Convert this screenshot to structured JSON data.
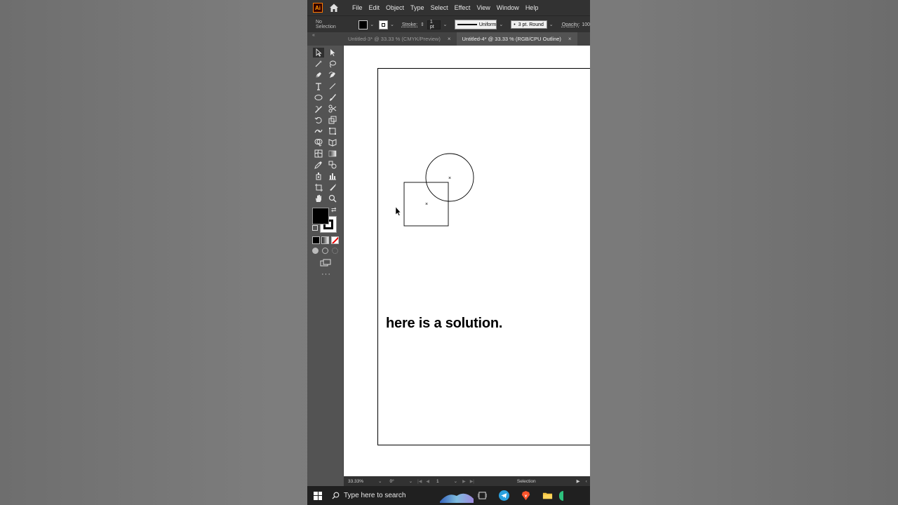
{
  "app": {
    "logo_text": "Ai",
    "brand_color": "#ff9a00"
  },
  "menubar": {
    "items": [
      "File",
      "Edit",
      "Object",
      "Type",
      "Select",
      "Effect",
      "View",
      "Window",
      "Help"
    ]
  },
  "controlbar": {
    "selection_label": "No Selection",
    "stroke_label": "Stroke:",
    "stroke_value": "1 pt",
    "profile_label": "Uniform",
    "brush_label": "3 pt. Round",
    "opacity_label": "Opacity:",
    "opacity_value": "100"
  },
  "tabs": [
    {
      "label": "Untitled-3* @ 33.33 % (CMYK/Preview)",
      "active": false
    },
    {
      "label": "Untitled-4* @ 33.33 % (RGB/CPU Outline)",
      "active": true
    }
  ],
  "tools": [
    "selection-tool",
    "direct-selection-tool",
    "magic-wand-tool",
    "lasso-tool",
    "pen-tool",
    "curvature-tool",
    "type-tool",
    "line-tool",
    "ellipse-tool",
    "paintbrush-tool",
    "shaper-tool",
    "scissors-tool",
    "rotate-tool",
    "scale-tool",
    "puppet-warp-tool",
    "free-transform-tool",
    "shape-builder-tool",
    "perspective-grid-tool",
    "mesh-tool",
    "gradient-tool",
    "eyedropper-tool",
    "blend-tool",
    "symbol-sprayer-tool",
    "column-graph-tool",
    "artboard-tool",
    "slice-tool",
    "hand-tool",
    "zoom-tool"
  ],
  "colors": {
    "fill": "#000000",
    "stroke": "#ffffff"
  },
  "canvas": {
    "caption": "here is a solution."
  },
  "statusbar": {
    "zoom": "33.33%",
    "rotation": "0°",
    "artboard_number": "1",
    "mode": "Selection"
  },
  "taskbar": {
    "search_placeholder": "Type here to search",
    "icons": [
      "task-view-icon",
      "telegram-icon",
      "brave-icon",
      "file-explorer-icon"
    ]
  }
}
